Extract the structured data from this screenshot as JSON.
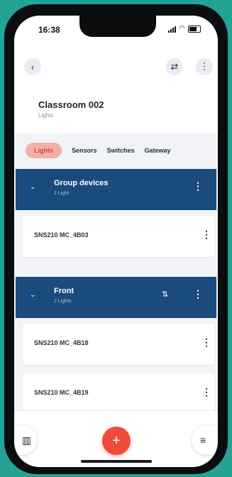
{
  "status_bar": {
    "time": "16:38"
  },
  "header": {
    "title": "Classroom 002",
    "subtitle": "Lights",
    "back_icon": "‹",
    "swap_icon": "⇄",
    "more_icon": "⋮"
  },
  "tabs": [
    {
      "label": "Lights",
      "active": true
    },
    {
      "label": "Sensors",
      "active": false
    },
    {
      "label": "Switches",
      "active": false
    },
    {
      "label": "Gateway",
      "active": false
    }
  ],
  "groups": [
    {
      "name": "Group devices",
      "subtitle": "1 Light",
      "collapse_icon": "⌄",
      "more_icon": "⋮",
      "devices": [
        {
          "name": "SNS210 MC_4B03",
          "more_icon": "⋮"
        }
      ]
    },
    {
      "name": "Front",
      "subtitle": "2 Lights",
      "collapse_icon": "⌄",
      "settings_icon": "⇅",
      "more_icon": "⋮",
      "devices": [
        {
          "name": "SNS210 MC_4B18",
          "more_icon": "⋮"
        },
        {
          "name": "SNS210 MC_4B19",
          "more_icon": "⋮"
        }
      ]
    }
  ],
  "bottom_bar": {
    "building_icon": "▥",
    "add_icon": "+",
    "menu_icon": "≡"
  },
  "colors": {
    "group_header": "#1a4b7c",
    "active_tab_bg": "#f4b0a8",
    "active_tab_text": "#c9463a",
    "fab": "#ef4a3c",
    "backdrop": "#24a394"
  }
}
